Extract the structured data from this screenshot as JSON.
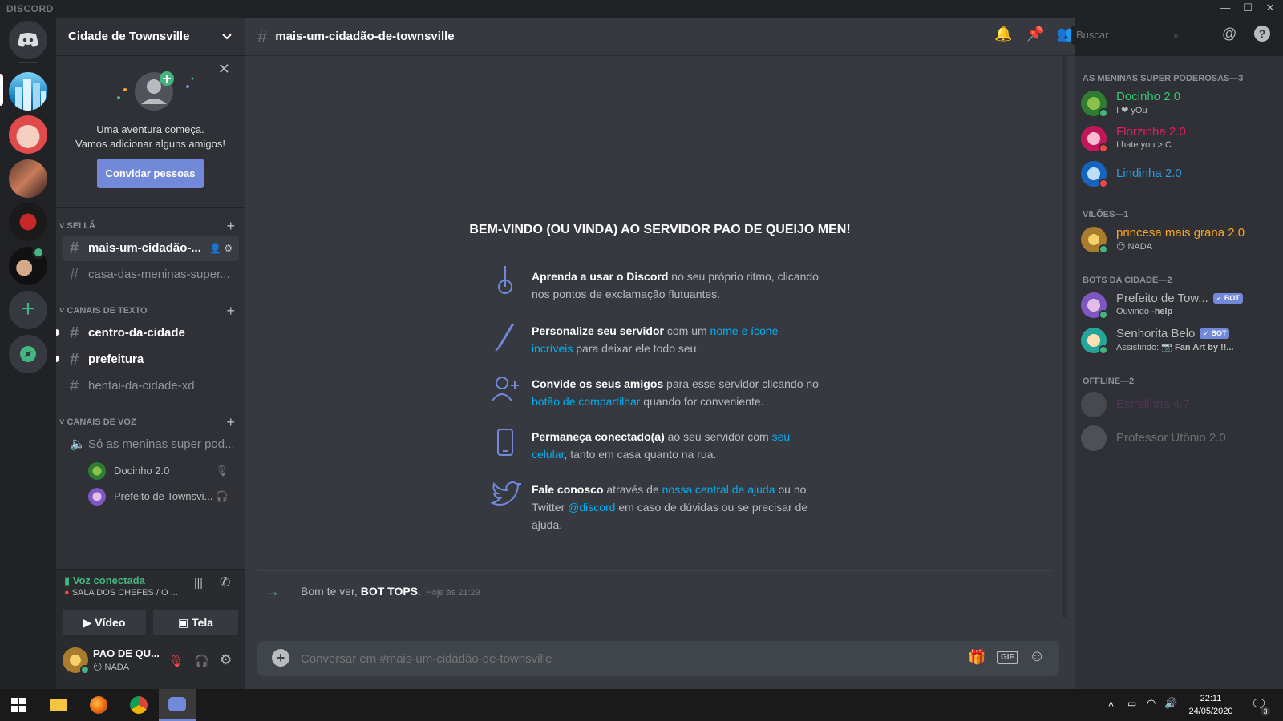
{
  "titlebar": {
    "brand": "DISCORD",
    "minimize": "—",
    "maximize": "☐",
    "close": "✕"
  },
  "guild": {
    "name": "Cidade de Townsville"
  },
  "invite": {
    "line1": "Uma aventura começa.",
    "line2": "Vamos adicionar alguns amigos!",
    "button": "Convidar pessoas"
  },
  "categories": {
    "sei_la": "SEI LÁ",
    "texto": "CANAIS DE TEXTO",
    "voz": "CANAIS DE VOZ"
  },
  "channels": {
    "active": "mais-um-cidadão-...",
    "c2": "casa-das-meninas-super...",
    "c3": "centro-da-cidade",
    "c4": "prefeitura",
    "c5": "hentai-da-cidade-xd",
    "voice": "Só as meninas super pod..."
  },
  "voice_users": [
    "Docinho 2.0",
    "Prefeito de Townsvi..."
  ],
  "voice_status": {
    "title": "Voz conectada",
    "room": "SALA DOS CHEFES / O ...",
    "video": "Vídeo",
    "screen": "Tela"
  },
  "user": {
    "name": "PAO DE QU...",
    "status": "NADA"
  },
  "chat": {
    "channel": "mais-um-cidadão-de-townsville",
    "welcome": "BEM-VINDO (OU VINDA) AO SERVIDOR PAO DE QUEIJO MEN!",
    "tips": [
      {
        "bold": "Aprenda a usar o Discord",
        "a": " no seu próprio ritmo, clicando nos pontos de exclamação flutuantes.",
        "link": "",
        "b": ""
      },
      {
        "bold": "Personalize seu servidor",
        "a": " com um ",
        "link": "nome e ícone incríveis",
        "b": " para deixar ele todo seu."
      },
      {
        "bold": "Convide os seus amigos",
        "a": " para esse servidor clicando no ",
        "link": "botão de compartilhar",
        "b": " quando for conveniente."
      },
      {
        "bold": "Permaneça conectado(a)",
        "a": " ao seu servidor com ",
        "link": "seu celular",
        "b": ", tanto em casa quanto na rua."
      },
      {
        "bold": "Fale conosco",
        "a": " através de ",
        "link": "nossa central de ajuda",
        "b": " ou no Twitter ",
        "link2": "@discord",
        "c": " em caso de dúvidas ou se precisar de ajuda."
      }
    ],
    "sys_prefix": "Bom te ver, ",
    "sys_user": "BOT TOPS",
    "sys_suffix": ".",
    "sys_time": "Hoje às 21:29",
    "placeholder": "Conversar em #mais-um-cidadão-de-townsville",
    "search_placeholder": "Buscar",
    "gif": "GIF"
  },
  "members": {
    "cat1": "AS MENINAS SUPER PODEROSAS—3",
    "cat2": "VILÕES—1",
    "cat3": "BOTS DA CIDADE—2",
    "cat4": "OFFLINE—2",
    "m1": {
      "name": "Docinho 2.0",
      "sub": "I ❤ yOu"
    },
    "m2": {
      "name": "Florzinha 2.0",
      "sub": "I hate you >:C"
    },
    "m3": {
      "name": "Lindinha 2.0"
    },
    "m4": {
      "name": "princesa mais grana 2.0",
      "sub": "NADA"
    },
    "m5": {
      "name": "Prefeito de Tow...",
      "sub_a": "Ouvindo ",
      "sub_b": "-help",
      "tag": "✓ BOT"
    },
    "m6": {
      "name": "Senhorita Belo",
      "sub_a": "Assistindo: ",
      "sub_b": "Fan Art by !!...",
      "tag": "✓ BOT"
    },
    "m7": {
      "name": "Estrelinha 4.7"
    },
    "m8": {
      "name": "Professor Utônio 2.0"
    }
  },
  "taskbar": {
    "time": "22:11",
    "date": "24/05/2020",
    "notif": "3"
  },
  "colors": {
    "blurple": "#7289da",
    "green": "#43b581",
    "red": "#f04747",
    "link": "#00b0f4",
    "pink": "#e91e63",
    "gold": "#faa61a",
    "blue": "#3498db"
  }
}
